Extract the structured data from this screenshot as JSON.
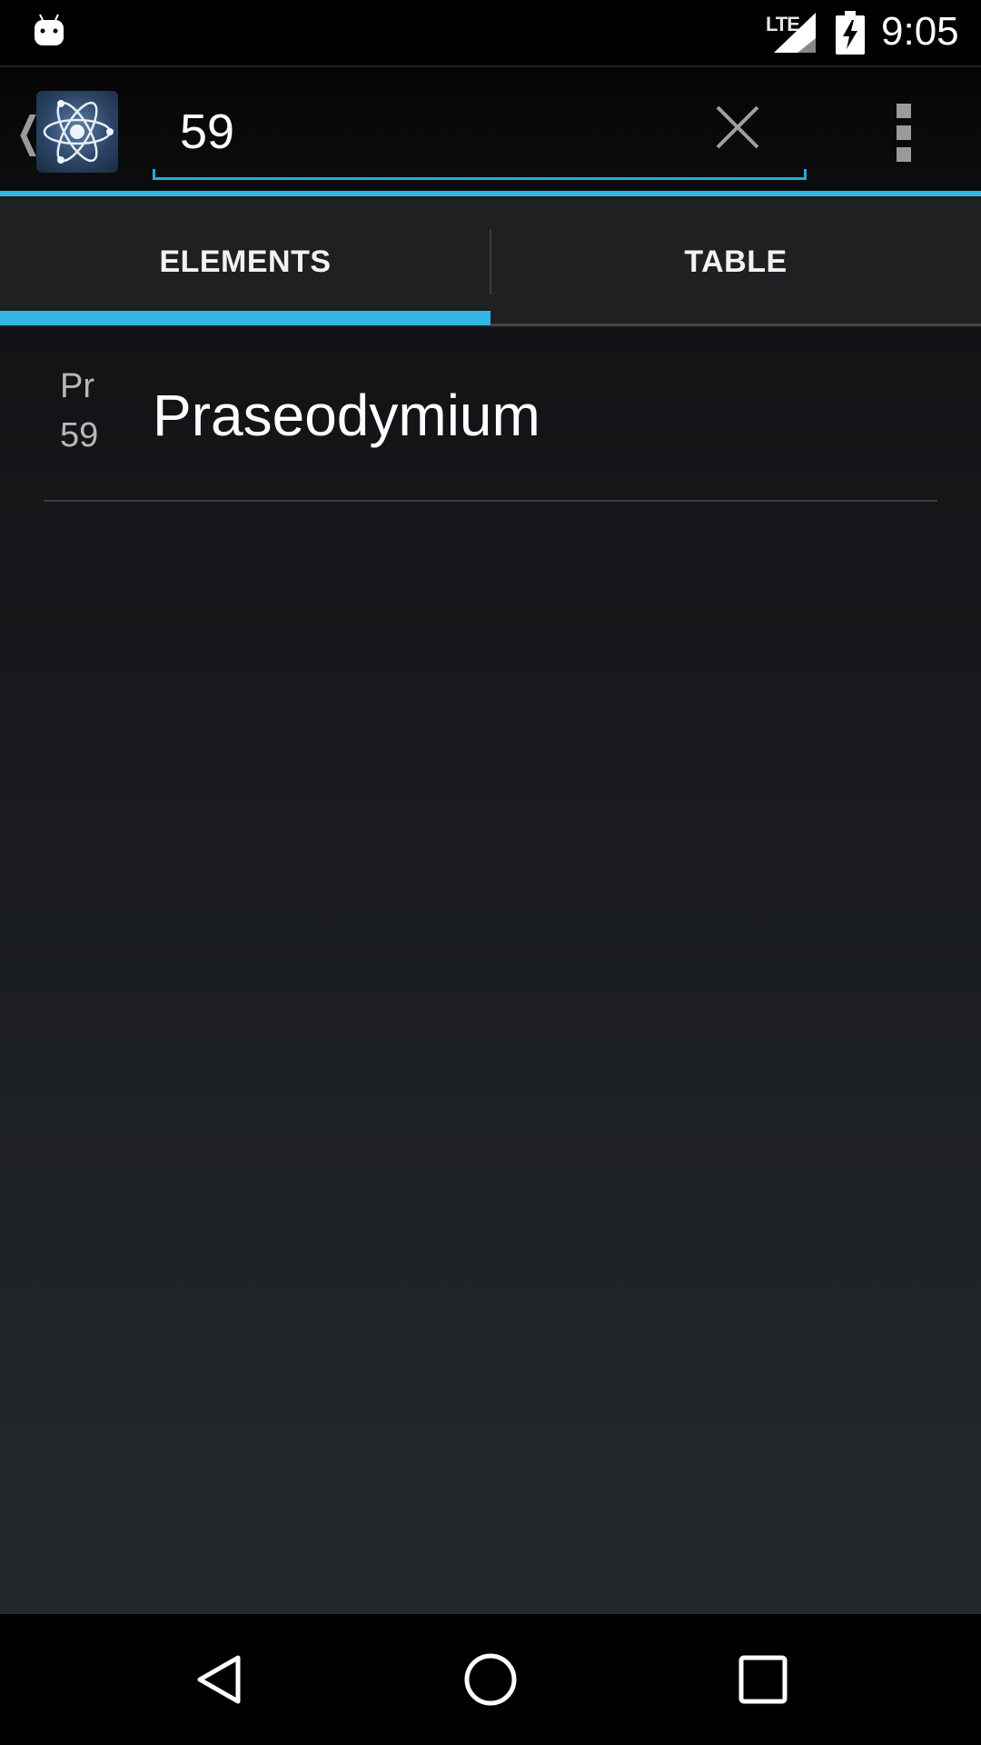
{
  "status_bar": {
    "network": "LTE",
    "time": "9:05",
    "icons": [
      "android-notification-icon",
      "signal-icon",
      "battery-charging-icon"
    ]
  },
  "action_bar": {
    "app_icon": "atom-icon",
    "search": {
      "value": "59",
      "placeholder": ""
    },
    "clear_icon": "close-icon",
    "overflow_icon": "overflow-menu-icon"
  },
  "tabs": [
    {
      "label": "ELEMENTS",
      "selected": true
    },
    {
      "label": "TABLE",
      "selected": false
    }
  ],
  "results": [
    {
      "symbol": "Pr",
      "number": "59",
      "name": "Praseodymium"
    }
  ],
  "colors": {
    "accent": "#33b5e5",
    "background_top": "#121315",
    "background_bottom": "#24282d"
  },
  "nav_bar": {
    "icons": [
      "back-icon",
      "home-icon",
      "recents-icon"
    ]
  }
}
